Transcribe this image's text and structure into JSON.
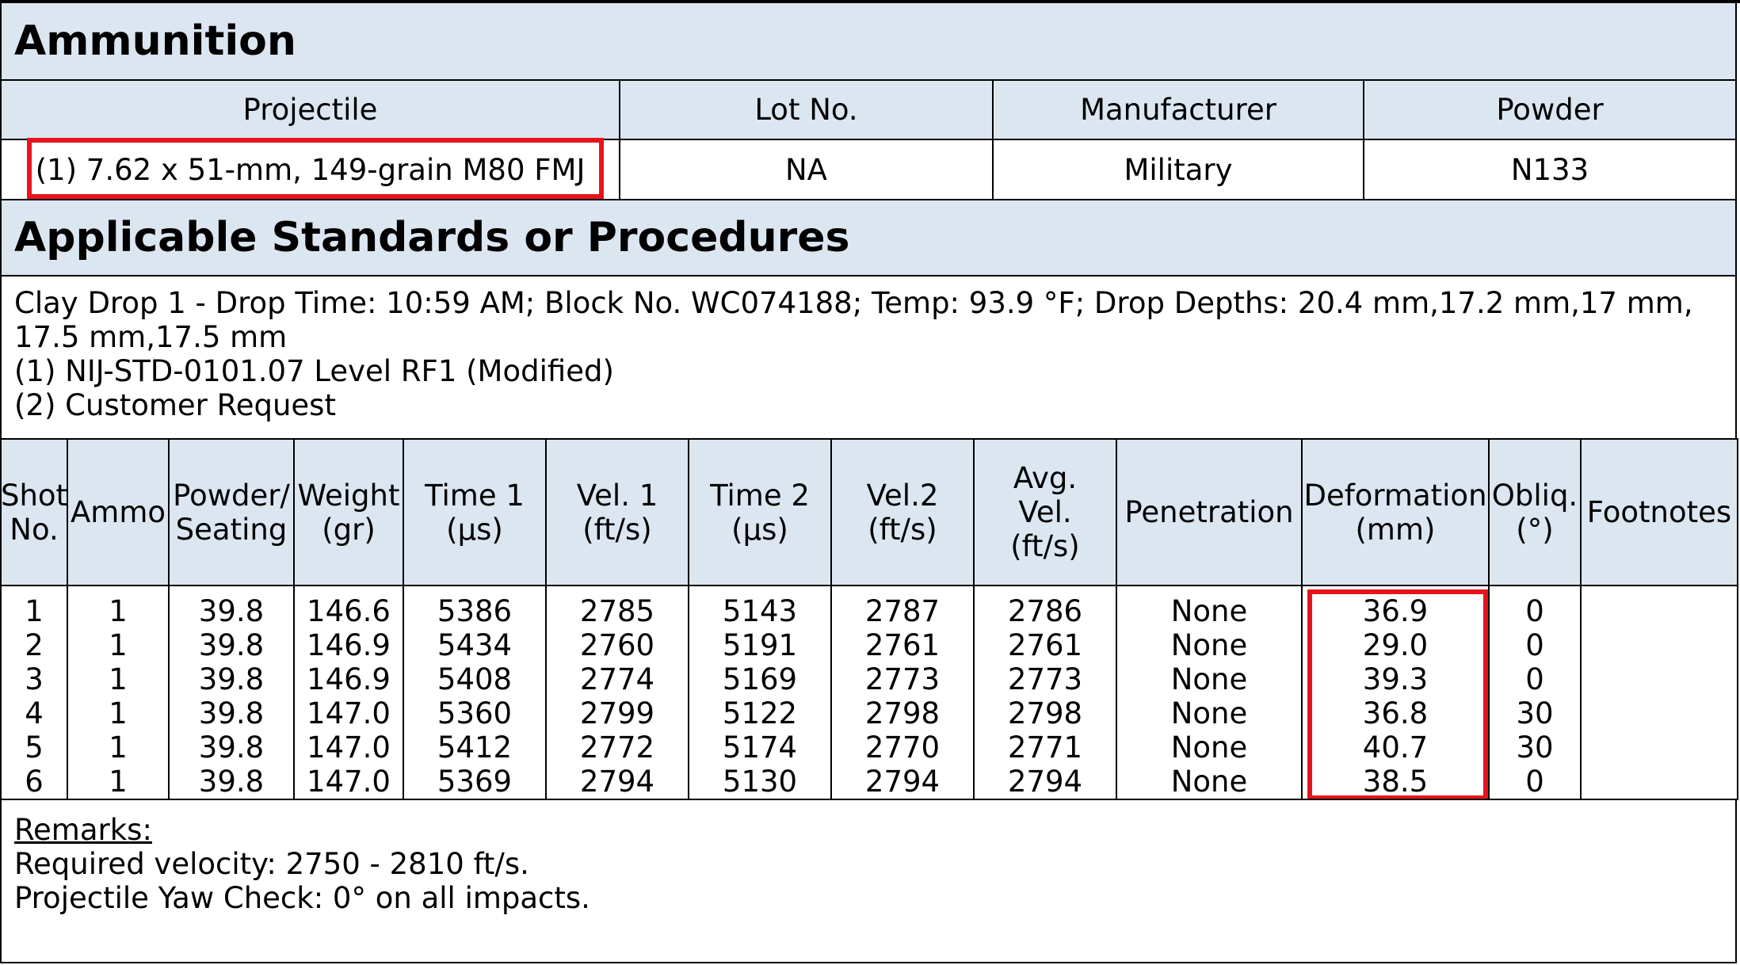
{
  "ammunition": {
    "title": "Ammunition",
    "headers": [
      "Projectile",
      "Lot No.",
      "Manufacturer",
      "Powder"
    ],
    "values": [
      "(1) 7.62 x 51-mm, 149-grain M80 FMJ",
      "NA",
      "Military",
      "N133"
    ]
  },
  "standards": {
    "title": "Applicable Standards or Procedures",
    "lines": [
      "Clay Drop 1 - Drop Time: 10:59 AM; Block No. WC074188; Temp: 93.9 °F; Drop Depths: 20.4 mm,17.2 mm,17 mm,",
      "17.5 mm,17.5 mm",
      "(1) NIJ-STD-0101.07 Level RF1 (Modified)",
      "(2) Customer Request"
    ]
  },
  "shots_table": {
    "headers": [
      [
        "Shot",
        "No."
      ],
      [
        "Ammo"
      ],
      [
        "Powder/",
        "Seating"
      ],
      [
        "Weight",
        "(gr)"
      ],
      [
        "Time 1",
        "(µs)"
      ],
      [
        "Vel. 1",
        "(ft/s)"
      ],
      [
        "Time 2",
        "(µs)"
      ],
      [
        "Vel.2",
        "(ft/s)"
      ],
      [
        "Avg.",
        "Vel.",
        "(ft/s)"
      ],
      [
        "Penetration"
      ],
      [
        "Deformation",
        "(mm)"
      ],
      [
        "Obliq.",
        "(°)"
      ],
      [
        "Footnotes"
      ]
    ],
    "columns": [
      [
        "1",
        "2",
        "3",
        "4",
        "5",
        "6"
      ],
      [
        "1",
        "1",
        "1",
        "1",
        "1",
        "1"
      ],
      [
        "39.8",
        "39.8",
        "39.8",
        "39.8",
        "39.8",
        "39.8"
      ],
      [
        "146.6",
        "146.9",
        "146.9",
        "147.0",
        "147.0",
        "147.0"
      ],
      [
        "5386",
        "5434",
        "5408",
        "5360",
        "5412",
        "5369"
      ],
      [
        "2785",
        "2760",
        "2774",
        "2799",
        "2772",
        "2794"
      ],
      [
        "5143",
        "5191",
        "5169",
        "5122",
        "5174",
        "5130"
      ],
      [
        "2787",
        "2761",
        "2773",
        "2798",
        "2770",
        "2794"
      ],
      [
        "2786",
        "2761",
        "2773",
        "2798",
        "2771",
        "2794"
      ],
      [
        "None",
        "None",
        "None",
        "None",
        "None",
        "None"
      ],
      [
        "36.9",
        "29.0",
        "39.3",
        "36.8",
        "40.7",
        "38.5"
      ],
      [
        "0",
        "0",
        "0",
        "30",
        "30",
        "0"
      ],
      [
        "",
        "",
        "",
        "",
        "",
        ""
      ]
    ]
  },
  "remarks": {
    "title": "Remarks:",
    "lines": [
      "Required velocity: 2750 - 2810 ft/s.",
      "Projectile Yaw Check: 0° on all impacts."
    ]
  },
  "colors": {
    "header_fill": "#dce6f1",
    "highlight": "#e8141c"
  }
}
